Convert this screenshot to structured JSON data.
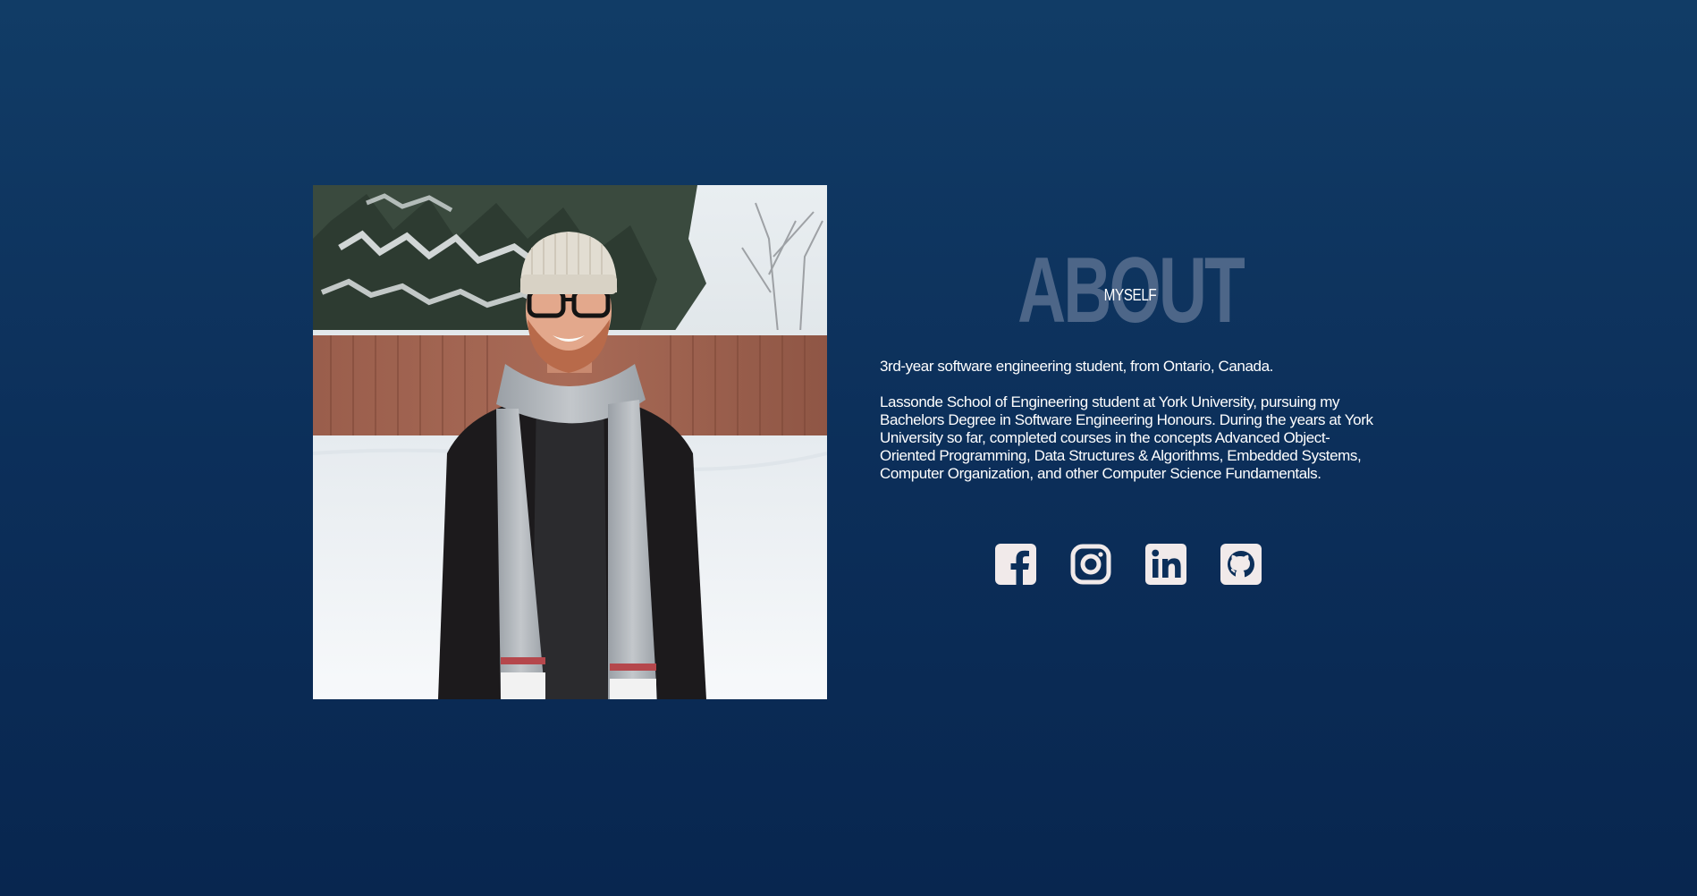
{
  "about": {
    "heading_big": "ABOUT",
    "heading_small": "MYSELF",
    "paragraph1": "3rd-year software engineering student, from Ontario, Canada.",
    "paragraph2": "Lassonde School of Engineering student at York University, pursuing my Bachelors Degree in Software Engineering Honours. During the years at York University so far, completed courses in the concepts Advanced Object-Oriented Programming, Data Structures & Algorithms, Embedded Systems, Computer Organization, and other Computer Science Fundamentals."
  },
  "socials": [
    {
      "name": "facebook",
      "icon": "facebook-icon"
    },
    {
      "name": "instagram",
      "icon": "instagram-icon"
    },
    {
      "name": "linkedin",
      "icon": "linkedin-icon"
    },
    {
      "name": "github",
      "icon": "github-icon"
    }
  ],
  "colors": {
    "background_top": "#113c66",
    "background_bottom": "#08264f",
    "heading_big": "#4d6688",
    "text": "#ffffff",
    "icon": "#f1eaea"
  }
}
